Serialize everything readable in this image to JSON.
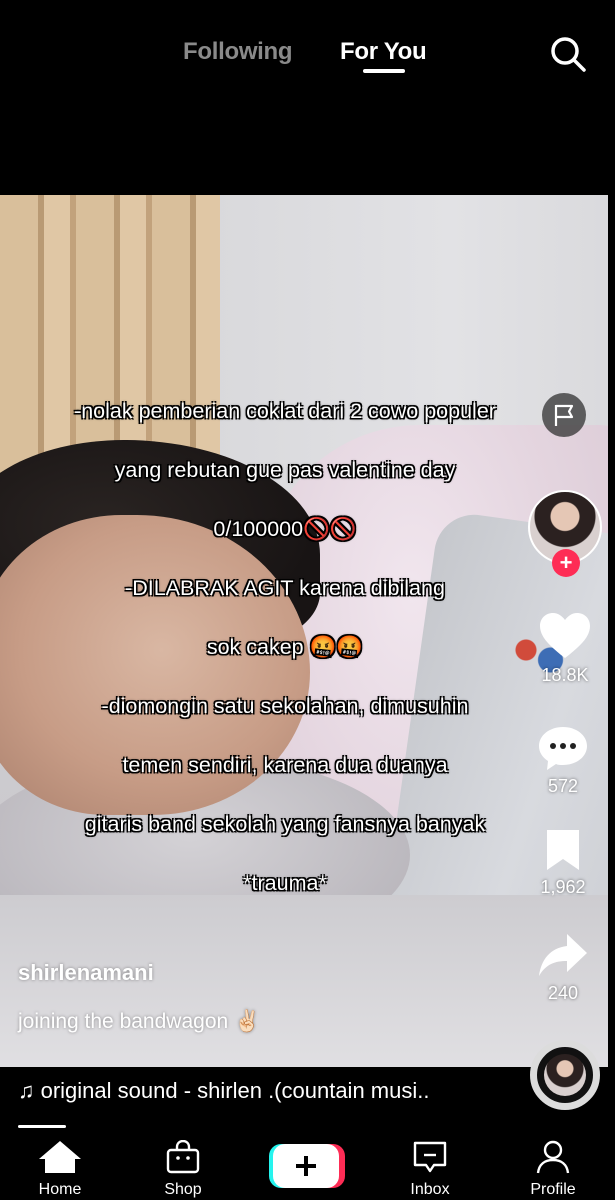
{
  "header": {
    "tabs": [
      {
        "label": "Following",
        "active": false
      },
      {
        "label": "For You",
        "active": true
      }
    ],
    "search_icon": "search-icon"
  },
  "video": {
    "caption_lines": [
      "-nolak pemberian coklat dari 2 cowo populer",
      "yang rebutan gue pas valentine day",
      "0/100000🚫🚫",
      "-DILABRAK AGIT karena dibilang",
      "sok cakep 🤬🤬",
      "-diomongin satu sekolahan, dimusuhin",
      "temen sendiri, karena dua duanya",
      "gitaris band sekolah yang fansnya banyak",
      "*trauma*"
    ],
    "username": "shirlenamani",
    "description": "joining the bandwagon ✌🏻"
  },
  "rail": {
    "likes": "18.8K",
    "comments": "572",
    "saves": "1,962",
    "shares": "240"
  },
  "sound": {
    "label": "♫ original sound - shirlen .(countain musi.."
  },
  "bottom_nav": {
    "home": "Home",
    "shop": "Shop",
    "inbox": "Inbox",
    "profile": "Profile"
  },
  "colors": {
    "accent": "#fe2c55",
    "create_cyan": "#25f4ee",
    "background": "#000000"
  }
}
